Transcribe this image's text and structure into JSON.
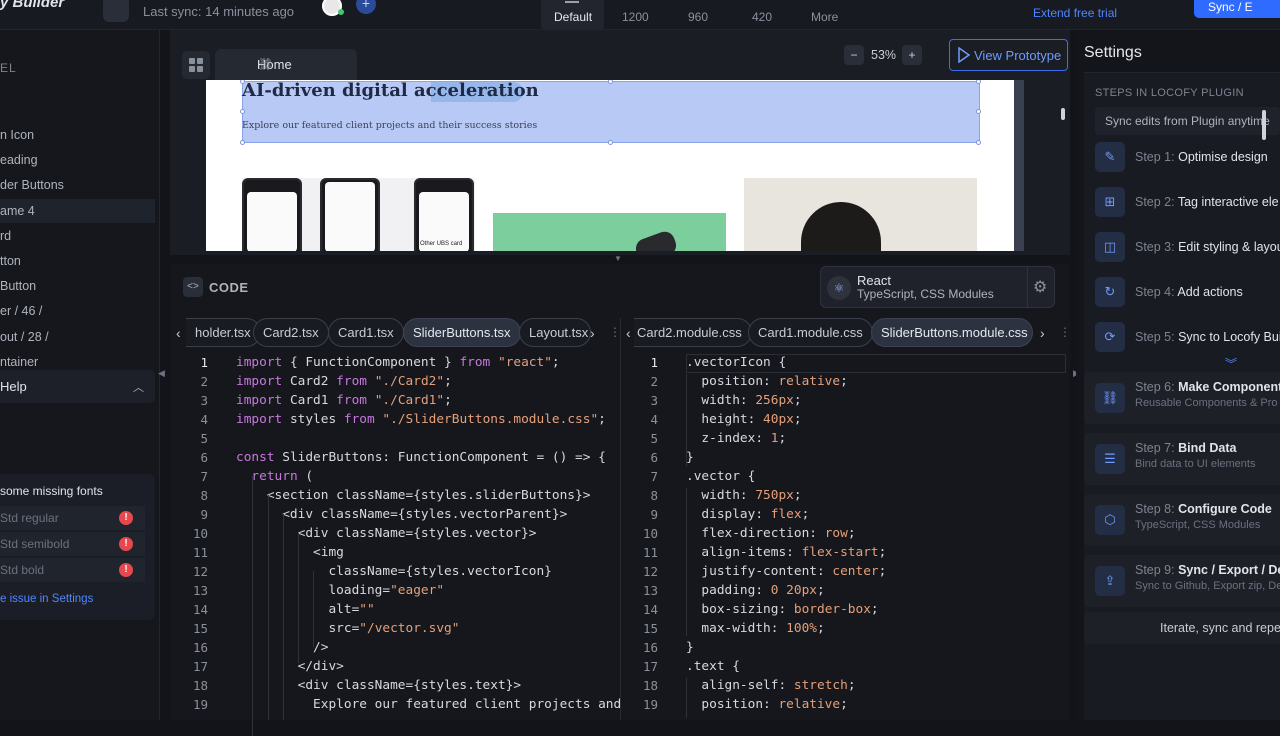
{
  "topbar": {
    "logo": "y Builder",
    "last_sync": "Last sync: 14 minutes ago",
    "breakpoints": [
      "Default",
      "1200",
      "960",
      "420",
      "More"
    ],
    "active_breakpoint": "Default",
    "trial_link": "Extend free trial",
    "export_button": "Sync / E"
  },
  "left_panel": {
    "section_label": "EL",
    "layers": [
      "n Icon",
      "eading",
      "der Buttons",
      "ame 4",
      "rd",
      "tton",
      "Button",
      "er / 46 /",
      "out / 28 /",
      "ntainer"
    ],
    "selected_layer": "ame 4",
    "help_label": "Help",
    "missing_fonts": {
      "title": "some missing fonts",
      "items": [
        "Std regular",
        "Std semibold",
        "Std bold"
      ],
      "link": "e issue in Settings"
    }
  },
  "canvas": {
    "tab_label": "Home",
    "zoom": "53%",
    "prototype_button": "View Prototype",
    "page_title": "AI-driven digital acceleration",
    "page_subtitle": "Explore our featured client projects and their success stories",
    "phone_card_label": "Other UBS card"
  },
  "code": {
    "title": "CODE",
    "framework_name": "React",
    "framework_sub": "TypeScript, CSS Modules",
    "left_tabs": [
      "holder.tsx",
      "Card2.tsx",
      "Card1.tsx",
      "SliderButtons.tsx",
      "Layout.tsx"
    ],
    "left_active": "SliderButtons.tsx",
    "right_tabs": [
      "Card2.module.css",
      "Card1.module.css",
      "SliderButtons.module.css"
    ],
    "right_active": "SliderButtons.module.css",
    "left_lines": [
      "import { FunctionComponent } from \"react\";",
      "import Card2 from \"./Card2\";",
      "import Card1 from \"./Card1\";",
      "import styles from \"./SliderButtons.module.css\";",
      "",
      "const SliderButtons: FunctionComponent = () => {",
      "  return (",
      "    <section className={styles.sliderButtons}>",
      "      <div className={styles.vectorParent}>",
      "        <div className={styles.vector}>",
      "          <img",
      "            className={styles.vectorIcon}",
      "            loading=\"eager\"",
      "            alt=\"\"",
      "            src=\"/vector.svg\"",
      "          />",
      "        </div>",
      "        <div className={styles.text}>",
      "          Explore our featured client projects and"
    ],
    "right_lines": [
      ".vectorIcon {",
      "  position: relative;",
      "  width: 256px;",
      "  height: 40px;",
      "  z-index: 1;",
      "}",
      ".vector {",
      "  width: 750px;",
      "  display: flex;",
      "  flex-direction: row;",
      "  align-items: flex-start;",
      "  justify-content: center;",
      "  padding: 0 20px;",
      "  box-sizing: border-box;",
      "  max-width: 100%;",
      "}",
      ".text {",
      "  align-self: stretch;",
      "  position: relative;"
    ]
  },
  "settings": {
    "title": "Settings",
    "steps_label": "STEPS IN LOCOFY PLUGIN",
    "sync_pill": "Sync edits from Plugin anytime",
    "steps": [
      {
        "num": "Step 1:",
        "label": "Optimise design",
        "sub": ""
      },
      {
        "num": "Step 2:",
        "label": "Tag interactive ele",
        "sub": ""
      },
      {
        "num": "Step 3:",
        "label": "Edit styling & layou",
        "sub": ""
      },
      {
        "num": "Step 4:",
        "label": "Add actions",
        "sub": ""
      },
      {
        "num": "Step 5:",
        "label": "Sync to Locofy Buil",
        "sub": ""
      },
      {
        "num": "Step 6:",
        "label": "Make Components",
        "sub": "Reusable Components & Pro"
      },
      {
        "num": "Step 7:",
        "label": "Bind Data",
        "sub": "Bind data to UI elements"
      },
      {
        "num": "Step 8:",
        "label": "Configure Code",
        "sub": "TypeScript, CSS Modules"
      },
      {
        "num": "Step 9:",
        "label": "Sync / Export / Dep",
        "sub": "Sync to Github, Export zip, De"
      }
    ],
    "iterate": "Iterate, sync and repe"
  }
}
